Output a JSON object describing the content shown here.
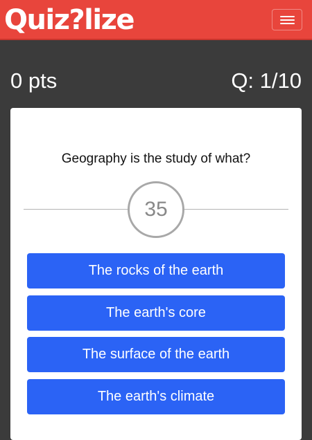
{
  "header": {
    "logo_text": "Quiz?lize",
    "menu_icon": "hamburger-menu-icon",
    "brand_color": "#e8453c"
  },
  "status": {
    "score": "0 pts",
    "question_counter": "Q: 1/10"
  },
  "quiz": {
    "question": "Geography is the study of what?",
    "timer": "35",
    "answers": [
      "The rocks of the earth",
      "The earth's core",
      "The surface of the earth",
      "The earth's climate"
    ],
    "answer_color": "#2b63f5"
  }
}
